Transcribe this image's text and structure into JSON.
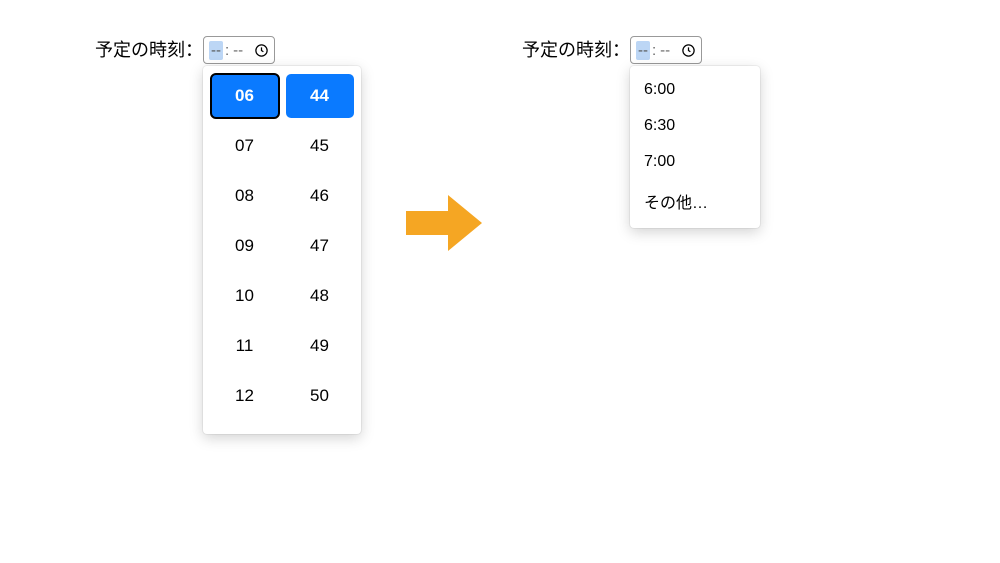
{
  "left": {
    "label": "予定の時刻：",
    "seg_hour": "--",
    "colon": ":",
    "seg_min": "--",
    "hours": [
      "06",
      "07",
      "08",
      "09",
      "10",
      "11",
      "12"
    ],
    "minutes": [
      "44",
      "45",
      "46",
      "47",
      "48",
      "49",
      "50"
    ]
  },
  "right": {
    "label": "予定の時刻：",
    "seg_hour": "--",
    "colon": ":",
    "seg_min": "--",
    "options": [
      "6:00",
      "6:30",
      "7:00",
      "その他…"
    ]
  },
  "colors": {
    "accent": "#0a7aff",
    "arrow": "#f5a623"
  }
}
